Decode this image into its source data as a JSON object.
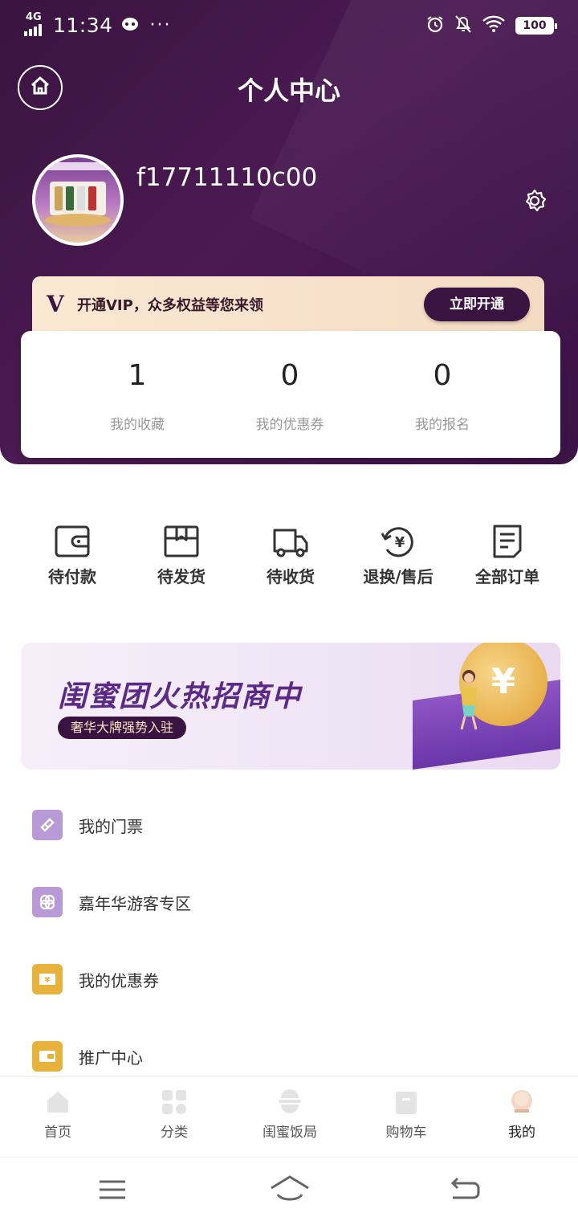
{
  "status_bar": {
    "network": "4G",
    "time": "11:34",
    "dots": "···",
    "battery": "100"
  },
  "header": {
    "title": "个人中心"
  },
  "profile": {
    "username": "f17711110c00"
  },
  "vip": {
    "badge": "V",
    "text": "开通VIP，众多权益等您来领",
    "button": "立即开通"
  },
  "stats": [
    {
      "value": "1",
      "label": "我的收藏"
    },
    {
      "value": "0",
      "label": "我的优惠券"
    },
    {
      "value": "0",
      "label": "我的报名"
    }
  ],
  "orders": [
    {
      "label": "待付款",
      "icon": "wallet-icon"
    },
    {
      "label": "待发货",
      "icon": "box-icon"
    },
    {
      "label": "待收货",
      "icon": "truck-icon"
    },
    {
      "label": "退换/售后",
      "icon": "refund-icon"
    },
    {
      "label": "全部订单",
      "icon": "order-list-icon"
    }
  ],
  "banner": {
    "title": "闺蜜团火热招商中",
    "tag": "奢华大牌强势入驻",
    "coin_symbol": "¥"
  },
  "menu": [
    {
      "label": "我的门票",
      "icon": "ticket-icon",
      "color": "#b79ad6"
    },
    {
      "label": "嘉年华游客专区",
      "icon": "carnival-icon",
      "color": "#b79ad6"
    },
    {
      "label": "我的优惠券",
      "icon": "coupon-icon",
      "color": "#e6b23c"
    },
    {
      "label": "推广中心",
      "icon": "promotion-icon",
      "color": "#e6b23c"
    }
  ],
  "tabbar": [
    {
      "label": "首页",
      "icon": "home-tab-icon"
    },
    {
      "label": "分类",
      "icon": "category-tab-icon"
    },
    {
      "label": "闺蜜饭局",
      "icon": "dinner-tab-icon"
    },
    {
      "label": "购物车",
      "icon": "cart-tab-icon"
    },
    {
      "label": "我的",
      "icon": "profile-tab-icon",
      "active": true
    }
  ],
  "colors": {
    "primary": "#3a1440",
    "accent_gold": "#e6b23c",
    "accent_lilac": "#b79ad6"
  }
}
